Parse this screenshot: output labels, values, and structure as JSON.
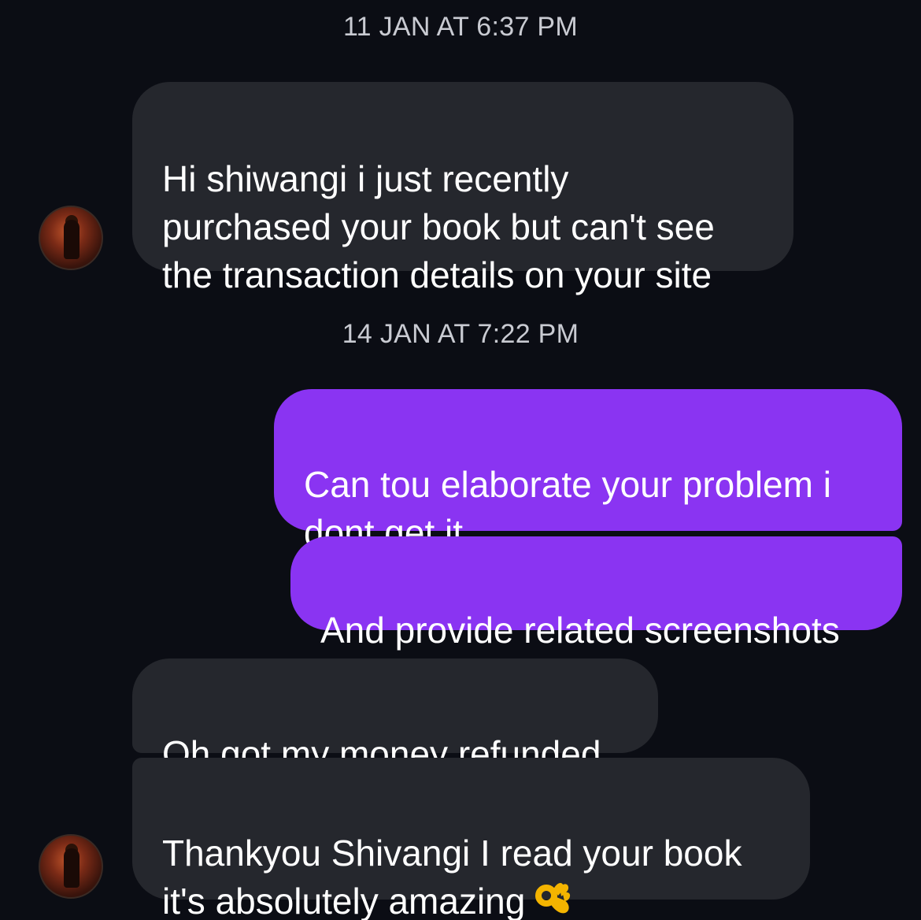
{
  "thread": {
    "timestamps": [
      "11 JAN AT 6:37 PM",
      "14 JAN AT 7:22 PM"
    ],
    "messages": [
      {
        "sender": "them",
        "text": "Hi shiwangi i just recently\npurchased your book but can't see\nthe transaction details on your site"
      },
      {
        "sender": "me",
        "text": "Can tou elaborate your problem i\ndont get it"
      },
      {
        "sender": "me",
        "text": "And provide related screenshots"
      },
      {
        "sender": "them",
        "text": "Oh got my money refunded"
      },
      {
        "sender": "them",
        "text": "Thankyou Shivangi I read your book\nit's absolutely amazing",
        "emoji": "ok-hand-emoji"
      }
    ]
  },
  "colors": {
    "background": "#0b0d14",
    "incoming_bubble": "#25272d",
    "outgoing_bubble": "#8a34f2",
    "timestamp_text": "#c9cbd2"
  }
}
